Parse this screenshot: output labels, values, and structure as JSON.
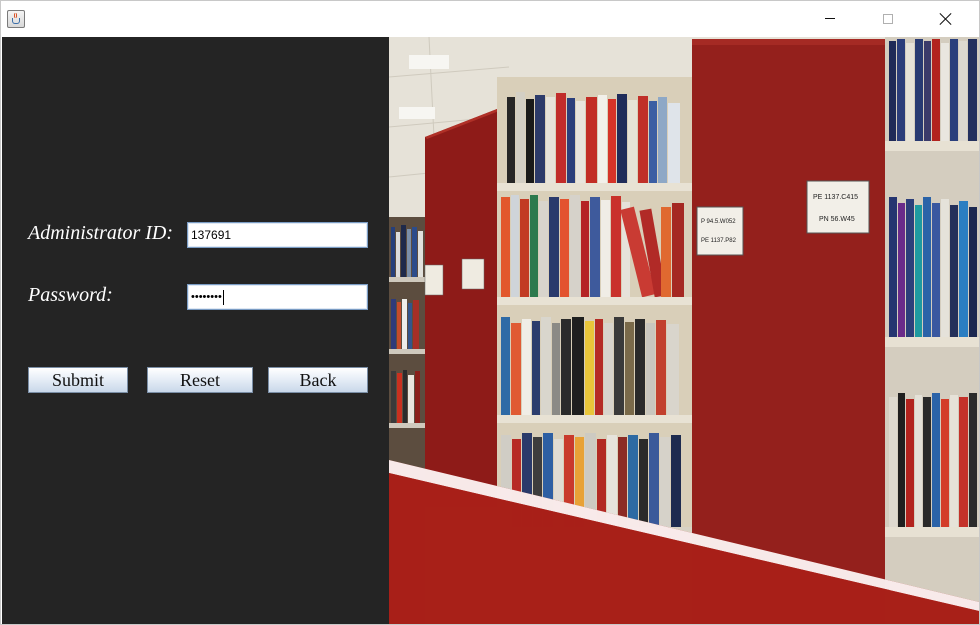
{
  "window": {
    "app_icon": "java-cup-icon",
    "controls": {
      "minimize": "minimize-icon",
      "maximize": "maximize-icon",
      "close": "close-icon"
    }
  },
  "form": {
    "admin_id_label": "Administrator ID:",
    "admin_id_value": "137691",
    "password_label": "Password:",
    "password_mask": "••••••••"
  },
  "buttons": {
    "submit": "Submit",
    "reset": "Reset",
    "back": "Back"
  },
  "image": {
    "shelf_labels": [
      "P 94.5.W052",
      "PE 1137.P82",
      "PE 1137.C415",
      "PN 56.W45"
    ]
  },
  "colors": {
    "panel_bg": "#242424",
    "banner_red": "#b3241c",
    "shelf_red": "#8e1b18"
  }
}
